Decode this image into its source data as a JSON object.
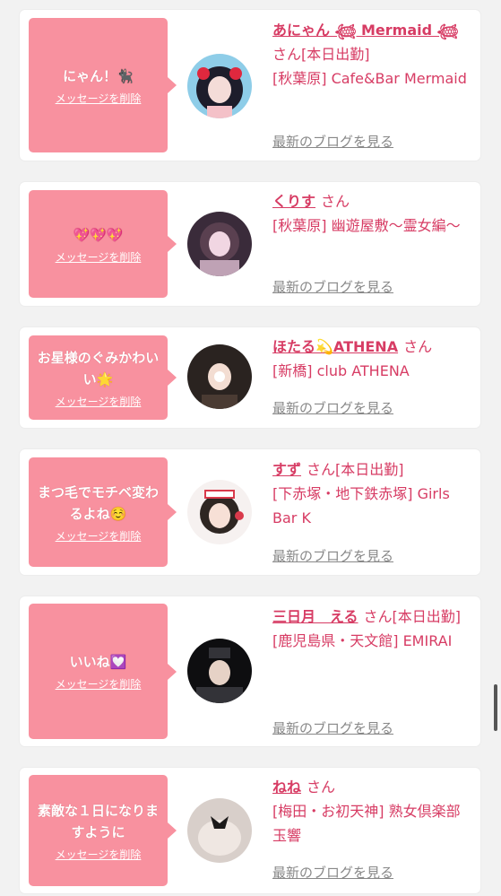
{
  "items": [
    {
      "message": "にゃん！🐈‍⬛",
      "delete_label": "メッセージを削除",
      "name": "あにゃん 𓆉 Mermaid 𓆉",
      "san": "さん[本日出勤]",
      "shop": "[秋葉原] Cafe&Bar Mermaid",
      "blog_label": "最新のブログを見る",
      "avatar_colors": [
        "#8ecde8",
        "#1d1d2b",
        "#f4c1c8"
      ]
    },
    {
      "message": "💖💖💖",
      "delete_label": "メッセージを削除",
      "name": "くりす",
      "san": "さん",
      "shop": "[秋葉原] 幽遊屋敷〜霊女編〜",
      "blog_label": "最新のブログを見る",
      "avatar_colors": [
        "#3a2b3a",
        "#f1d6e2",
        "#bfa2b5"
      ]
    },
    {
      "message": "お星様のぐみかわいい🌟",
      "delete_label": "メッセージを削除",
      "name": "ほたる💫ATHENA",
      "san": "さん",
      "shop": "[新橋] club ATHENA",
      "blog_label": "最新のブログを見る",
      "avatar_colors": [
        "#2a2320",
        "#f3ddd2",
        "#4a3b33"
      ]
    },
    {
      "message": "まつ毛でモチベ変わるよね☺️",
      "delete_label": "メッセージを削除",
      "name": "すず",
      "san": "さん[本日出勤]",
      "shop": "[下赤塚・地下鉄赤塚] Girls Bar K",
      "blog_label": "最新のブログを見る",
      "avatar_colors": [
        "#f6f1f0",
        "#2e2622",
        "#d93a4b"
      ]
    },
    {
      "message": "いいね💟",
      "delete_label": "メッセージを削除",
      "name": "三日月　える",
      "san": "さん[本日出勤]",
      "shop": "[鹿児島県・天文館] EMIRAI",
      "blog_label": "最新のブログを見る",
      "avatar_colors": [
        "#0e0e10",
        "#e6d2c6",
        "#333338"
      ]
    },
    {
      "message": "素敵な１日になりますように",
      "delete_label": "メッセージを削除",
      "name": "ねね",
      "san": "さん",
      "shop": "[梅田・お初天神] 熟女倶楽部 玉響",
      "blog_label": "最新のブログを見る",
      "avatar_colors": [
        "#d8cfca",
        "#1c1a1a",
        "#efe7e2"
      ]
    }
  ]
}
